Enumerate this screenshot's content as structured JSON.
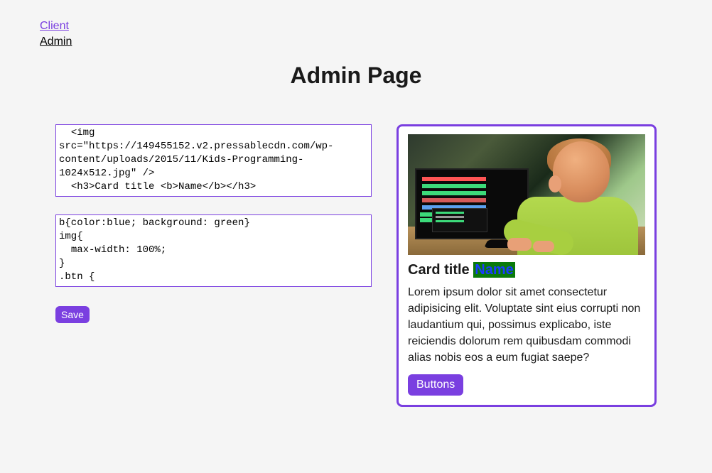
{
  "nav": {
    "client": "Client",
    "admin": "Admin"
  },
  "page_title": "Admin Page",
  "editors": {
    "html_value": "  <img src=\"https://149455152.v2.pressablecdn.com/wp-content/uploads/2015/11/Kids-Programming-1024x512.jpg\" />\n  <h3>Card title <b>Name</b></h3>",
    "css_value": "b{color:blue; background: green}\nimg{\n  max-width: 100%;\n}\n.btn {"
  },
  "buttons": {
    "save": "Save",
    "card_button": "Buttons"
  },
  "card": {
    "title_prefix": "Card title ",
    "title_name": "Name",
    "body": "Lorem ipsum dolor sit amet consectetur adipisicing elit. Voluptate sint eius corrupti non laudantium qui, possimus explicabo, iste reiciendis dolorum rem quibusdam commodi alias nobis eos a eum fugiat saepe?"
  }
}
